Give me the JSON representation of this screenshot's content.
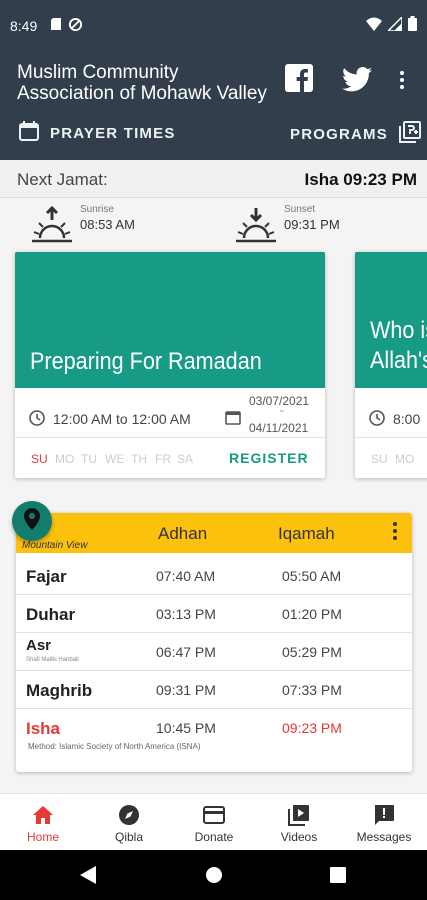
{
  "status": {
    "time": "8:49"
  },
  "appbar": {
    "title": "Muslim Community Association of Mohawk Valley"
  },
  "nav": {
    "prayer_times": "PRAYER TIMES",
    "programs": "PROGRAMS"
  },
  "next_jamat": {
    "label": "Next Jamat:",
    "value": "Isha 09:23 PM"
  },
  "sun": {
    "sunrise_label": "Sunrise",
    "sunrise_time": "08:53 AM",
    "sunset_label": "Sunset",
    "sunset_time": "09:31 PM"
  },
  "cards": [
    {
      "title": "Preparing For Ramadan",
      "time": "12:00 AM to 12:00 AM",
      "date_start": "03/07/2021",
      "date_end": "04/11/2021",
      "days": [
        "SU",
        "MO",
        "TU",
        "WE",
        "TH",
        "FR",
        "SA"
      ],
      "register": "REGISTER"
    },
    {
      "title_line1": "Who is",
      "title_line2": "Allah's",
      "time": "8:00",
      "days": [
        "SU",
        "MO"
      ]
    }
  ],
  "prayers": {
    "location": "Mountain View",
    "adhan_header": "Adhan",
    "iqamah_header": "Iqamah",
    "rows": [
      {
        "name": "Fajar",
        "adhan": "07:40 AM",
        "iqamah": "05:50 AM"
      },
      {
        "name": "Duhar",
        "adhan": "03:13 PM",
        "iqamah": "01:20 PM"
      },
      {
        "name": "Asr",
        "sub": "Shafi Maliki Hanbali",
        "adhan": "06:47 PM",
        "iqamah": "05:29 PM"
      },
      {
        "name": "Maghrib",
        "adhan": "09:31 PM",
        "iqamah": "07:33 PM"
      },
      {
        "name": "Isha",
        "adhan": "10:45 PM",
        "iqamah": "09:23 PM"
      }
    ],
    "method": "Method: Islamic Society of North America (ISNA)"
  },
  "bottom_nav": {
    "home": "Home",
    "qibla": "Qibla",
    "donate": "Donate",
    "videos": "Videos",
    "messages": "Messages"
  },
  "colors": {
    "header": "#323e4c",
    "teal": "#179a86",
    "yellow": "#fcc10c",
    "red": "#e53935"
  }
}
